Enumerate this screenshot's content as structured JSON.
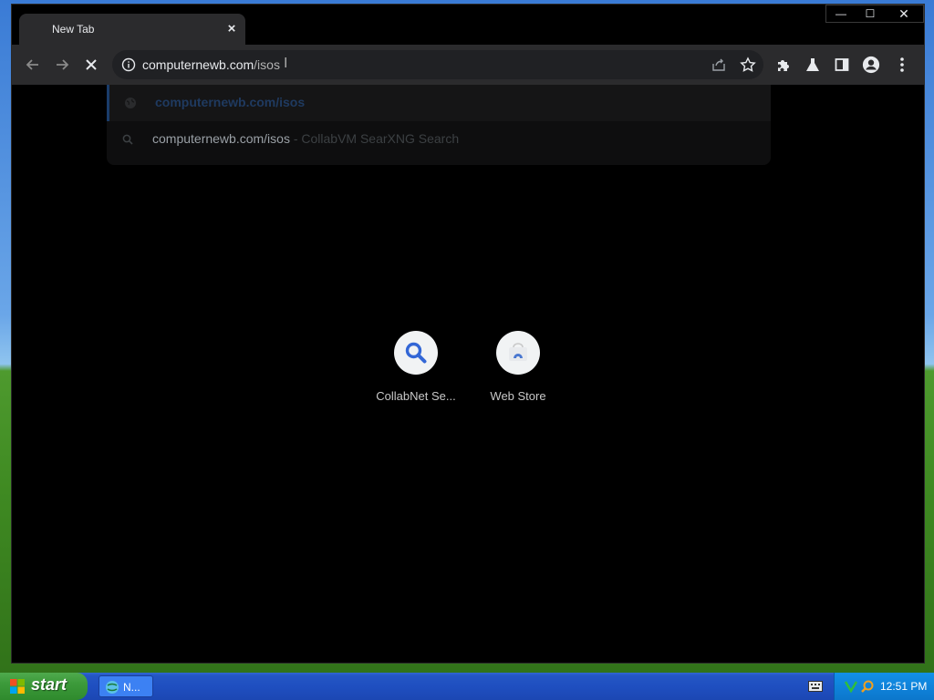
{
  "browser": {
    "tab": {
      "title": "New Tab",
      "close_label": "×"
    },
    "window_controls": {
      "minimize": "—",
      "maximize": "☐",
      "close": "✕"
    },
    "toolbar": {
      "back_icon": "back-arrow-icon",
      "forward_icon": "forward-arrow-icon",
      "stop_icon": "stop-loading-icon",
      "omnibox": {
        "url_host": "computernewb.com",
        "url_path": "/isos",
        "site_info_icon": "info-icon",
        "share_icon": "share-icon",
        "bookmark_icon": "star-icon"
      },
      "extensions_icon": "puzzle-icon",
      "labs_icon": "flask-icon",
      "sidepanel_icon": "side-panel-icon",
      "profile_icon": "account-icon",
      "menu_icon": "kebab-menu-icon"
    },
    "dropdown": {
      "suggestions": [
        {
          "icon": "globe-icon",
          "text": "computernewb.com/isos",
          "subtext": ""
        },
        {
          "icon": "search-icon",
          "text": "computernewb.com/isos",
          "subtext": " - CollabVM SearXNG Search"
        }
      ]
    },
    "shortcuts": [
      {
        "label": "CollabNet Se...",
        "icon": "magnifier-icon"
      },
      {
        "label": "Web Store",
        "icon": "web-store-icon"
      }
    ]
  },
  "taskbar": {
    "start_label": "start",
    "task_item_label": "N...",
    "clock": "12:51 PM"
  },
  "colors": {
    "accent_blue": "#2456c4",
    "start_green": "#3c9a3a",
    "tray_blue": "#0f83da",
    "browser_toolbar": "#2b2b2d"
  }
}
